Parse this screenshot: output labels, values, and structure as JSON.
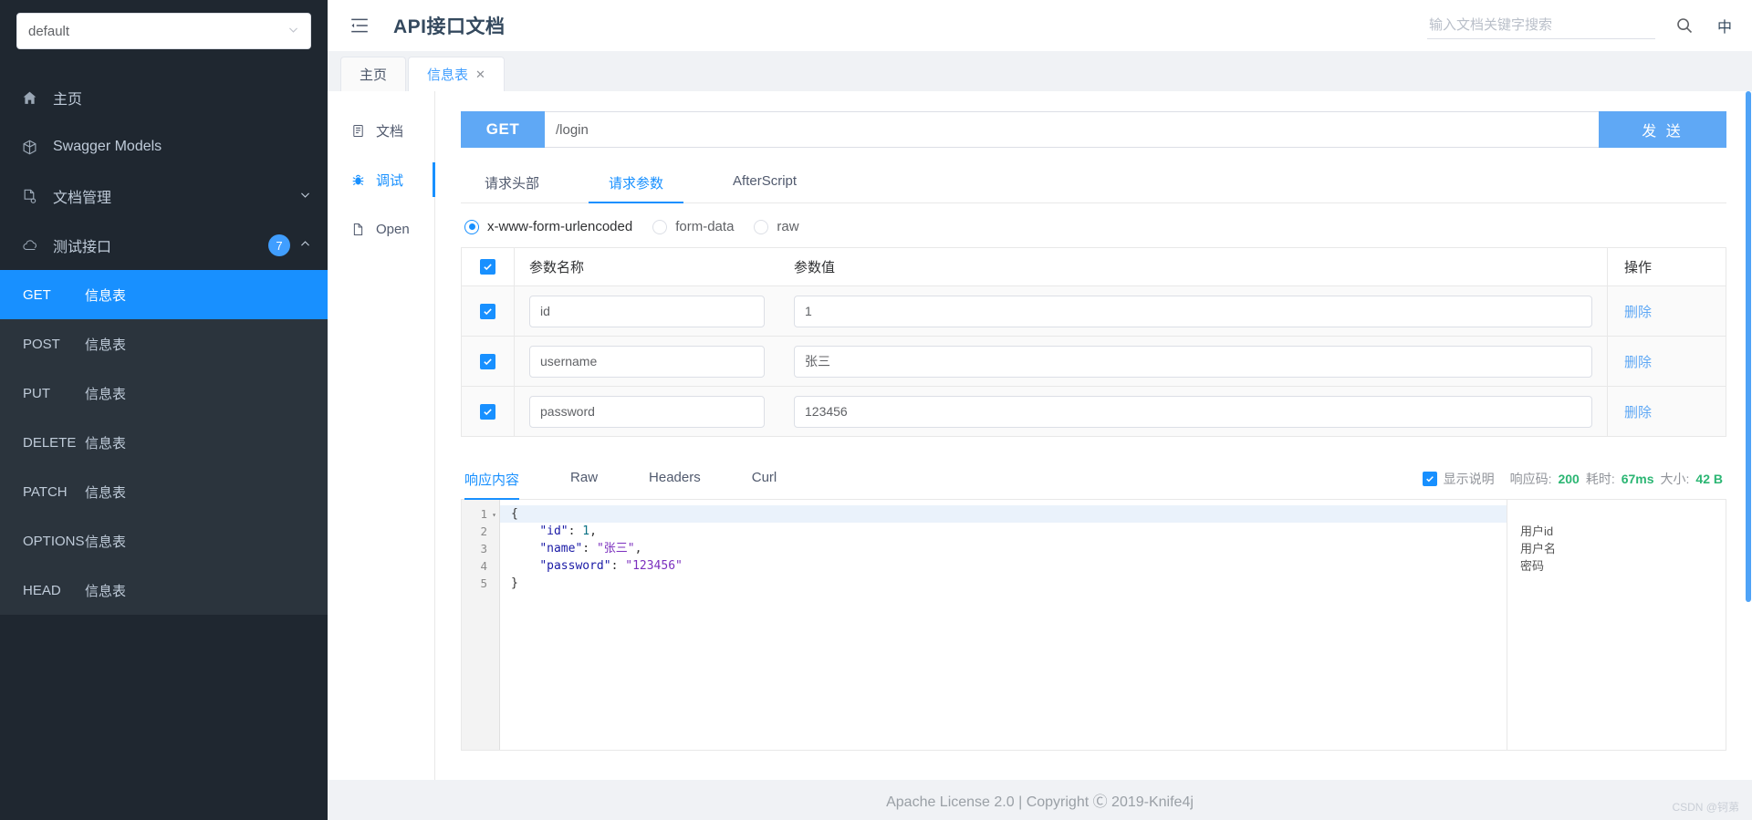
{
  "sidebar": {
    "selector": {
      "value": "default",
      "icon": "chevron-down-icon"
    },
    "nav": [
      {
        "label": "主页",
        "icon": "home-icon"
      },
      {
        "label": "Swagger Models",
        "icon": "swagger-icon"
      },
      {
        "label": "文档管理",
        "icon": "document-settings-icon",
        "chevron": "⌄"
      },
      {
        "label": "测试接口",
        "icon": "cloud-api-icon",
        "badge": "7",
        "chevron": "⌃"
      }
    ],
    "endpoints": [
      {
        "method": "GET",
        "name": "信息表",
        "active": true
      },
      {
        "method": "POST",
        "name": "信息表",
        "active": false
      },
      {
        "method": "PUT",
        "name": "信息表",
        "active": false
      },
      {
        "method": "DELETE",
        "name": "信息表",
        "active": false
      },
      {
        "method": "PATCH",
        "name": "信息表",
        "active": false
      },
      {
        "method": "OPTIONS",
        "name": "信息表",
        "active": false
      },
      {
        "method": "HEAD",
        "name": "信息表",
        "active": false
      }
    ]
  },
  "topbar": {
    "title": "API接口文档",
    "collapse_icon": "menu-fold-icon",
    "search_placeholder": "输入文档关键字搜索",
    "search_value": "",
    "search_icon": "search-icon",
    "lang_label": "中"
  },
  "tabs": [
    {
      "label": "主页",
      "closable": false,
      "active": false
    },
    {
      "label": "信息表",
      "closable": true,
      "close_glyph": "✕",
      "active": true
    }
  ],
  "innernav": [
    {
      "label": "文档",
      "icon": "document-icon",
      "active": false
    },
    {
      "label": "调试",
      "icon": "bug-icon",
      "active": true
    },
    {
      "label": "Open",
      "icon": "file-icon",
      "active": false
    }
  ],
  "request": {
    "method": "GET",
    "url": "/login",
    "url_placeholder": "",
    "send_label": "发 送",
    "tabs": [
      {
        "label": "请求头部",
        "active": false
      },
      {
        "label": "请求参数",
        "active": true
      },
      {
        "label": "AfterScript",
        "active": false
      }
    ],
    "body_types": [
      {
        "label": "x-www-form-urlencoded",
        "selected": true
      },
      {
        "label": "form-data",
        "selected": false
      },
      {
        "label": "raw",
        "selected": false
      }
    ],
    "table": {
      "headers": {
        "name": "参数名称",
        "value": "参数值",
        "action": "操作"
      },
      "header_checked": true,
      "rows": [
        {
          "checked": true,
          "name": "id",
          "name_placeholder": "参数名称",
          "value": "1",
          "value_placeholder": "参数值",
          "action": "删除"
        },
        {
          "checked": true,
          "name": "username",
          "name_placeholder": "参数名称",
          "value": "张三",
          "value_placeholder": "参数值",
          "action": "删除"
        },
        {
          "checked": true,
          "name": "password",
          "name_placeholder": "参数名称",
          "value": "123456",
          "value_placeholder": "参数值",
          "action": "删除"
        }
      ]
    }
  },
  "response": {
    "tabs": [
      {
        "label": "响应内容",
        "active": true
      },
      {
        "label": "Raw",
        "active": false
      },
      {
        "label": "Headers",
        "active": false
      },
      {
        "label": "Curl",
        "active": false
      }
    ],
    "show_desc_checked": true,
    "show_desc_label": "显示说明",
    "meta": [
      {
        "key": "响应码:",
        "value": "200"
      },
      {
        "key": "耗时:",
        "value": "67ms"
      },
      {
        "key": "大小:",
        "value": "42 B"
      }
    ],
    "code": {
      "line_numbers": [
        "1",
        "2",
        "3",
        "4",
        "5"
      ],
      "fold_marker": "▾",
      "lines": [
        {
          "text": "{",
          "type": "brace",
          "highlight": true
        },
        {
          "key": "\"id\"",
          "sep": ": ",
          "value": "1",
          "value_type": "num",
          "trail": ","
        },
        {
          "key": "\"name\"",
          "sep": ": ",
          "value": "\"张三\"",
          "value_type": "str",
          "trail": ","
        },
        {
          "key": "\"password\"",
          "sep": ": ",
          "value": "\"123456\"",
          "value_type": "str",
          "trail": ""
        },
        {
          "text": "}",
          "type": "brace",
          "highlight": false
        }
      ],
      "annotations": [
        "",
        "用户id",
        "用户名",
        "密码",
        ""
      ]
    }
  },
  "footer": {
    "text": "Apache License 2.0 | Copyright Ⓒ 2019-Knife4j",
    "watermark": "CSDN @钶苐"
  },
  "colors": {
    "sidebar_bg": "#1f2730",
    "sidebar_sub_bg": "#2b343d",
    "accent": "#1890ff",
    "method_blue": "#5fa8f5",
    "status_green": "#2bb673"
  }
}
